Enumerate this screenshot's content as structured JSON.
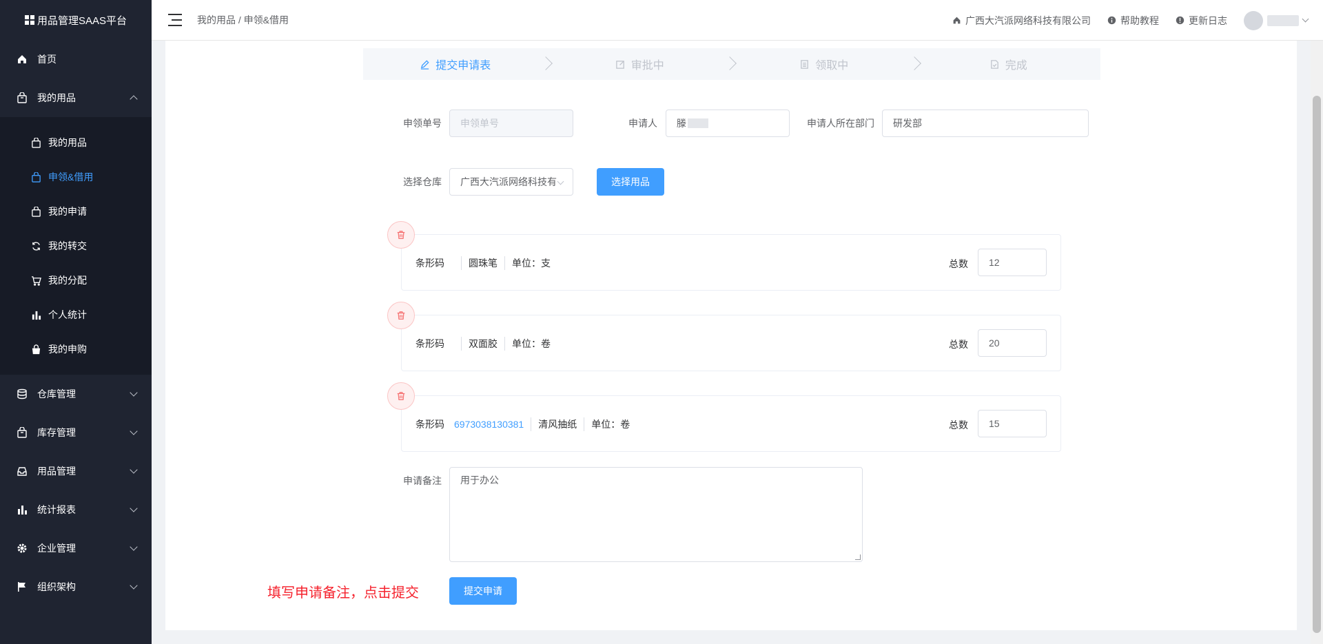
{
  "app": {
    "title": "用品管理SAAS平台"
  },
  "sidebar": {
    "home": "首页",
    "my_supplies": "我的用品",
    "sub_items": [
      {
        "label": "我的用品"
      },
      {
        "label": "申领&借用"
      },
      {
        "label": "我的申请"
      },
      {
        "label": "我的转交"
      },
      {
        "label": "我的分配"
      },
      {
        "label": "个人统计"
      },
      {
        "label": "我的申购"
      }
    ],
    "groups": [
      {
        "label": "仓库管理"
      },
      {
        "label": "库存管理"
      },
      {
        "label": "用品管理"
      },
      {
        "label": "统计报表"
      },
      {
        "label": "企业管理"
      },
      {
        "label": "组织架构"
      }
    ],
    "active_color": "#409eff"
  },
  "header": {
    "breadcrumb": "我的用品 / 申领&借用",
    "company": "广西大汽派网络科技有限公司",
    "help": "帮助教程",
    "changelog": "更新日志"
  },
  "steps": [
    {
      "label": "提交申请表",
      "icon": "edit-icon",
      "active": true
    },
    {
      "label": "审批中",
      "icon": "edit-box-icon",
      "active": false
    },
    {
      "label": "领取中",
      "icon": "document-icon",
      "active": false
    },
    {
      "label": "完成",
      "icon": "check-document-icon",
      "active": false
    }
  ],
  "form": {
    "order_no_label": "申领单号",
    "order_no_placeholder": "申领单号",
    "applicant_label": "申请人",
    "applicant_value": "滕",
    "department_label": "申请人所在部门",
    "department_value": "研发部",
    "warehouse_label": "选择仓库",
    "warehouse_value": "广西大汽派网络科技有",
    "choose_item_button": "选择用品",
    "remark_label": "申请备注",
    "remark_value": "用于办公",
    "submit_button": "提交申请"
  },
  "items": [
    {
      "barcode_label": "条形码",
      "barcode": "",
      "name": "圆珠笔",
      "unit": "单位：支",
      "total_label": "总数",
      "total": "12"
    },
    {
      "barcode_label": "条形码",
      "barcode": "",
      "name": "双面胶",
      "unit": "单位：卷",
      "total_label": "总数",
      "total": "20"
    },
    {
      "barcode_label": "条形码",
      "barcode": "6973038130381",
      "name": "清风抽纸",
      "unit": "单位：卷",
      "total_label": "总数",
      "total": "15"
    }
  ],
  "annotation": "填写申请备注，点击提交"
}
